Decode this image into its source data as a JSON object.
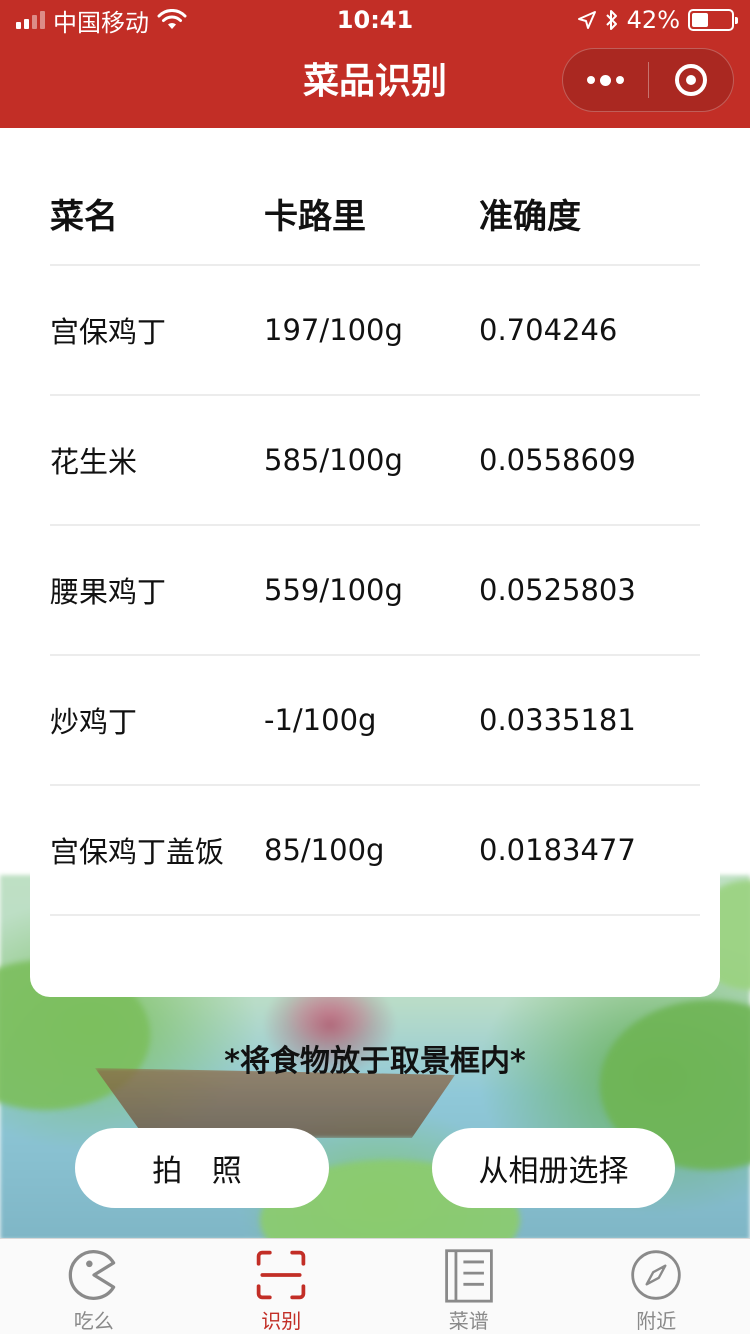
{
  "status_bar": {
    "carrier": "中国移动",
    "time": "10:41",
    "battery": "42%",
    "battery_level": 0.42
  },
  "nav": {
    "title": "菜品识别"
  },
  "table": {
    "headers": {
      "name": "菜名",
      "calories": "卡路里",
      "accuracy": "准确度"
    },
    "rows": [
      {
        "name": "宫保鸡丁",
        "calories": "197/100g",
        "accuracy": "0.704246"
      },
      {
        "name": "花生米",
        "calories": "585/100g",
        "accuracy": "0.0558609"
      },
      {
        "name": "腰果鸡丁",
        "calories": "559/100g",
        "accuracy": "0.0525803"
      },
      {
        "name": "炒鸡丁",
        "calories": "-1/100g",
        "accuracy": "0.0335181"
      },
      {
        "name": "宫保鸡丁盖饭",
        "calories": "85/100g",
        "accuracy": "0.0183477"
      }
    ]
  },
  "hint": "*将食物放于取景框内*",
  "buttons": {
    "photo": "拍 照",
    "album": "从相册选择"
  },
  "tabs": [
    {
      "label": "吃么",
      "icon": "pacman-icon",
      "active": false
    },
    {
      "label": "识别",
      "icon": "scan-icon",
      "active": true
    },
    {
      "label": "菜谱",
      "icon": "recipe-book-icon",
      "active": false
    },
    {
      "label": "附近",
      "icon": "compass-icon",
      "active": false
    }
  ],
  "colors": {
    "brand_red": "#c22e26",
    "tab_inactive": "#8a8a8a"
  }
}
